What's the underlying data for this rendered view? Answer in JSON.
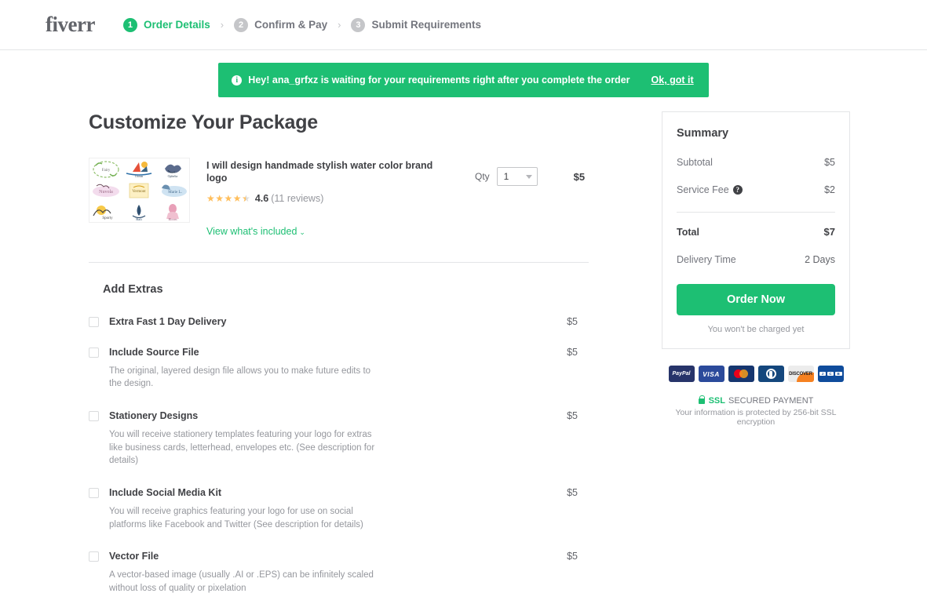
{
  "header": {
    "logo": "fiverr",
    "steps": [
      {
        "num": "1",
        "label": "Order Details",
        "state": "active"
      },
      {
        "num": "2",
        "label": "Confirm & Pay",
        "state": "inactive"
      },
      {
        "num": "3",
        "label": "Submit Requirements",
        "state": "inactive"
      }
    ],
    "separator": "›"
  },
  "banner": {
    "icon": "info-icon",
    "text": "Hey! ana_grfxz is waiting for your requirements right after you complete the order",
    "link": "Ok, got it",
    "color": "#1dbf73"
  },
  "main": {
    "page_title": "Customize Your Package",
    "gig": {
      "title": "I will design handmade stylish water color brand logo",
      "rating_score": "4.6",
      "rating_count": "(11 reviews)",
      "stars_filled": 4,
      "stars_half": 1,
      "included_link": "View what's included",
      "chevron": "∨",
      "qty_label": "Qty",
      "qty_value": "1",
      "price": "$5",
      "thumbnail_cells": [
        "Fairy Meadow",
        "Reflection in the Ocean",
        "Ophelia Kay",
        "Nuvola",
        "Vermont",
        "Marie Louise",
        "Hip Map Sporty",
        "Bali Pedicab",
        "Beautiful Bloom"
      ]
    },
    "extras_title": "Add Extras",
    "extras": [
      {
        "label": "Extra Fast 1 Day Delivery",
        "price": "$5",
        "desc": "",
        "checked": false
      },
      {
        "label": "Include Source File",
        "price": "$5",
        "desc": "The original, layered design file allows you to make future edits to the design.",
        "checked": false
      },
      {
        "label": "Stationery Designs",
        "price": "$5",
        "desc": "You will receive stationery templates featuring your logo for extras like business cards, letterhead, envelopes etc. (See description for details)",
        "checked": false
      },
      {
        "label": "Include Social Media Kit",
        "price": "$5",
        "desc": "You will receive graphics featuring your logo for use on social platforms like Facebook and Twitter (See description for details)",
        "checked": false
      },
      {
        "label": "Vector File",
        "price": "$5",
        "desc": "A vector-based image (usually .AI or .EPS) can be infinitely scaled without loss of quality or pixelation",
        "checked": false
      }
    ]
  },
  "summary": {
    "title": "Summary",
    "subtotal_label": "Subtotal",
    "subtotal_value": "$5",
    "fee_label": "Service Fee",
    "fee_help": "?",
    "fee_value": "$2",
    "total_label": "Total",
    "total_value": "$7",
    "delivery_label": "Delivery Time",
    "delivery_value": "2 Days",
    "order_button": "Order Now",
    "charge_note": "You won't be charged yet"
  },
  "payments": {
    "methods": [
      "PayPal",
      "VISA",
      "Mastercard",
      "Diners Club",
      "DISCOVER",
      "JCB"
    ],
    "ssl_badge": "SSL",
    "ssl_label": "SECURED PAYMENT",
    "ssl_note": "Your information is protected by 256-bit SSL encryption"
  }
}
